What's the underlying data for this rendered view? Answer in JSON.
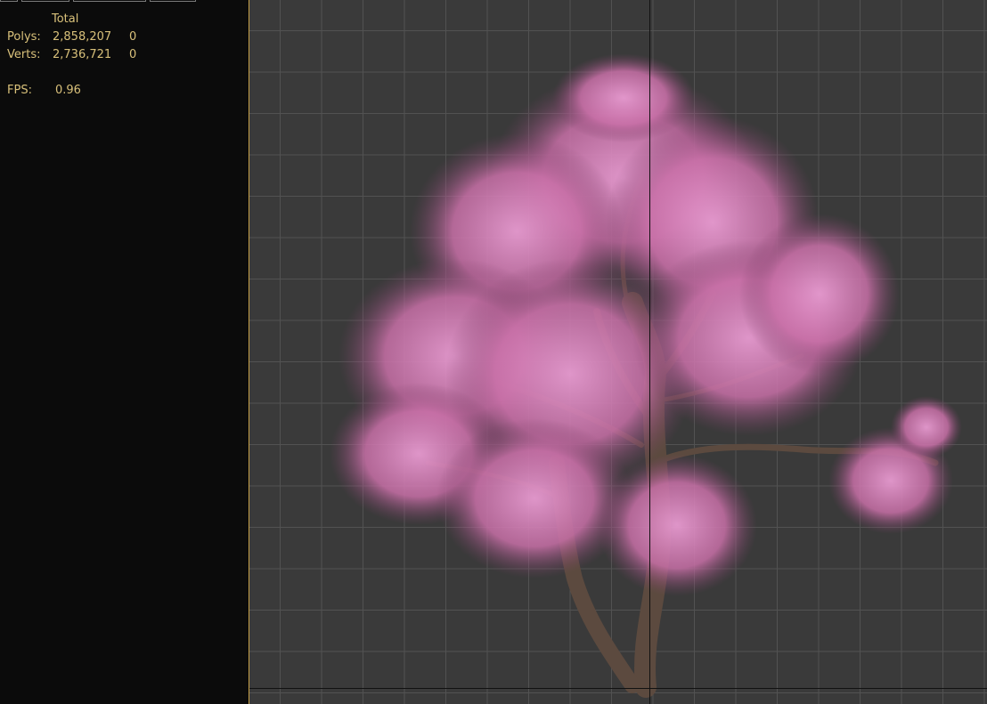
{
  "stats": {
    "column_header": "Total",
    "rows": [
      {
        "label": "Polys:",
        "total": "2,858,207",
        "selected": "0"
      },
      {
        "label": "Verts:",
        "total": "2,736,721",
        "selected": "0"
      }
    ],
    "fps_label": "FPS:",
    "fps_value": "0.96"
  },
  "colors": {
    "stats_text": "#d8c07a",
    "panel_bg": "#0b0b0b",
    "viewport_bg": "#3a3a3a",
    "grid_line": "#525252",
    "viewport_border": "#c8a24a",
    "blossom": "#d880b4",
    "bark": "#5c4a3f"
  },
  "viewport": {
    "content": "pink blossom tree model"
  }
}
